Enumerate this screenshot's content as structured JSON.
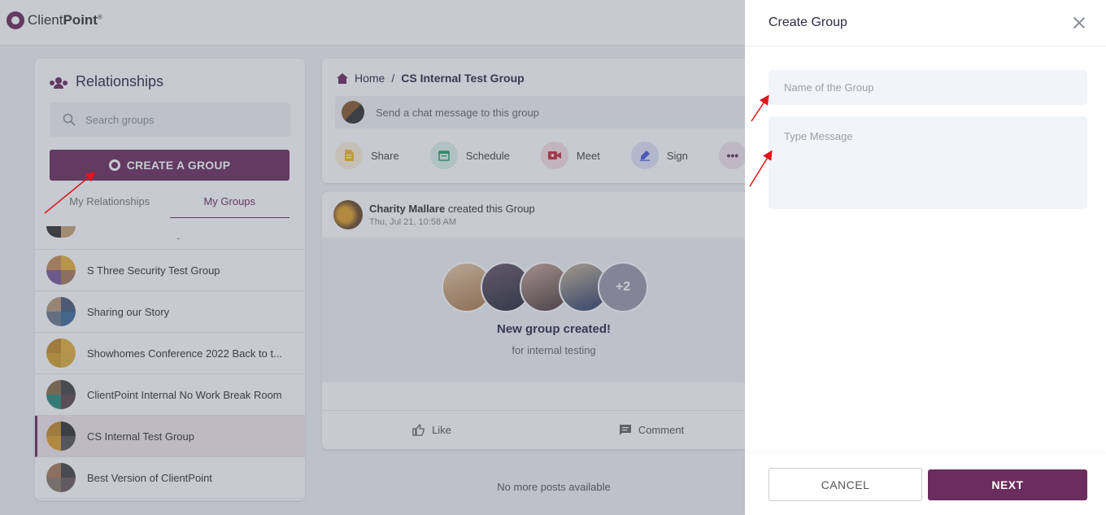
{
  "app": {
    "logo_text_light": "Client",
    "logo_text_bold": "Point",
    "logo_mark": "®"
  },
  "sidebar": {
    "title": "Relationships",
    "search_placeholder": "Search groups",
    "create_label": "CREATE A GROUP",
    "tabs": [
      {
        "label": "My Relationships",
        "active": false
      },
      {
        "label": "My Groups",
        "active": true
      }
    ],
    "partial_item_label": "-",
    "groups": [
      {
        "name": "S Three Security Test Group"
      },
      {
        "name": "Sharing our Story"
      },
      {
        "name": "Showhomes Conference 2022 Back to t..."
      },
      {
        "name": "ClientPoint Internal No Work Break Room"
      },
      {
        "name": "CS Internal Test Group",
        "selected": true
      },
      {
        "name": "Best Version of ClientPoint"
      }
    ]
  },
  "main": {
    "breadcrumb_home": "Home",
    "breadcrumb_sep": "/",
    "breadcrumb_current": "CS Internal Test Group",
    "chat_placeholder": "Send a chat message to this group",
    "actions": [
      {
        "label": "Share",
        "icon": "document-icon",
        "color": "#f5b82e"
      },
      {
        "label": "Schedule",
        "icon": "calendar-icon",
        "color": "#2e9e6b"
      },
      {
        "label": "Meet",
        "icon": "video-icon",
        "color": "#c4303f"
      },
      {
        "label": "Sign",
        "icon": "pen-icon",
        "color": "#4b5bd6"
      }
    ],
    "more_label": "•••"
  },
  "post": {
    "author": "Charity Mallare",
    "action_text": "created this Group",
    "date": "Thu, Jul 21, 10:58 AM",
    "extra_count": "+2",
    "banner_title": "New group created!",
    "banner_subtitle": "for internal testing",
    "like_label": "Like",
    "comment_label": "Comment",
    "no_more": "No more posts available"
  },
  "drawer": {
    "title": "Create Group",
    "name_placeholder": "Name of the Group",
    "message_placeholder": "Type Message",
    "cancel_label": "CANCEL",
    "next_label": "NEXT"
  },
  "colors": {
    "brand": "#6b2c5e",
    "annotation_arrow": "#e0141b"
  }
}
